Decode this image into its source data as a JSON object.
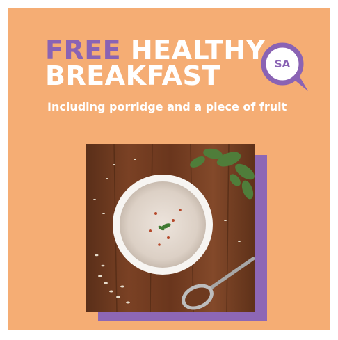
{
  "headline": {
    "word_free": "FREE",
    "word_healthy": "HEALTHY",
    "line2": "BREAKFAST"
  },
  "subtitle": "Including porridge and a piece of fruit",
  "badge": {
    "text": "SA"
  },
  "colors": {
    "background": "#f5ad74",
    "brand_purple": "#8a63b4",
    "text_white": "#ffffff"
  },
  "photo": {
    "subject": "bowl of porridge on wooden table with spoon and mint leaves"
  }
}
